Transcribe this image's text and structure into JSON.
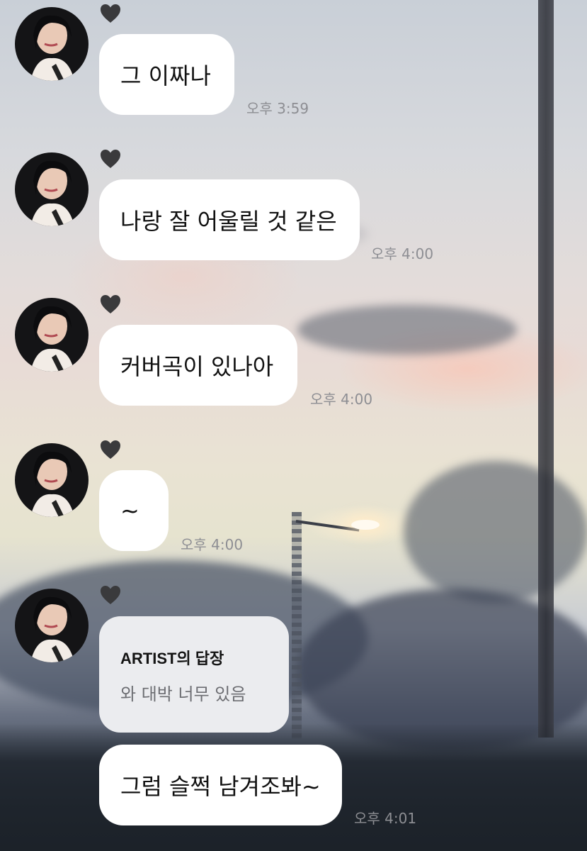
{
  "messages": [
    {
      "text": "그 이짜나",
      "time": "오후 3:59"
    },
    {
      "text": "나랑 잘 어울릴 것 같은",
      "time": "오후 4:00"
    },
    {
      "text": "커버곡이 있나아",
      "time": "오후 4:00"
    },
    {
      "text": "~",
      "time": "오후 4:00"
    }
  ],
  "reply": {
    "title": "ARTIST의 답장",
    "quoted": "와 대박 너무 있음",
    "text": "그럼 슬쩍 남겨조봐~",
    "time": "오후 4:01"
  },
  "icons": {
    "avatar": "profile-photo",
    "heart": "black-heart-icon"
  },
  "colors": {
    "bubble": "#ffffff",
    "reply_header_bubble": "#ebecef",
    "time": "#8d8e93",
    "heart": "#3a3a3c"
  }
}
